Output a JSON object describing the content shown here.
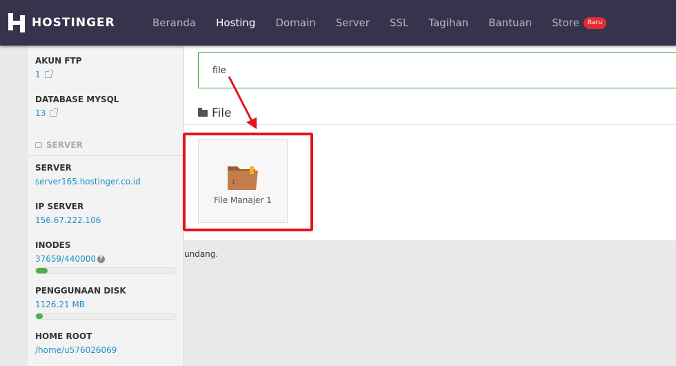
{
  "brand": {
    "name": "HOSTINGER"
  },
  "nav": {
    "items": [
      "Beranda",
      "Hosting",
      "Domain",
      "Server",
      "SSL",
      "Tagihan",
      "Bantuan",
      "Store"
    ],
    "active": "Hosting",
    "store_badge": "Baru"
  },
  "sidebar": {
    "ftp": {
      "title": "AKUN FTP",
      "value": "1"
    },
    "mysql": {
      "title": "DATABASE MYSQL",
      "value": "13"
    },
    "section_label": "SERVER",
    "server": {
      "title": "SERVER",
      "value": "server165.hostinger.co.id"
    },
    "ip": {
      "title": "IP SERVER",
      "value": "156.67.222.106"
    },
    "inodes": {
      "title": "INODES",
      "value": "37659/440000",
      "help": "?",
      "usage": 0.086
    },
    "disk": {
      "title": "PENGGUNAAN DISK",
      "value": "1126.21 MB",
      "usage": 0.05
    },
    "home": {
      "title": "HOME ROOT",
      "value": "/home/u576026069"
    }
  },
  "main": {
    "search_value": "file",
    "section_title": "File",
    "tile_label": "File Manajer 1",
    "tile_badge": "1",
    "footer_text": "undang."
  },
  "colors": {
    "topbar": "#36344d",
    "link": "#1e8fc7",
    "highlight": "#e6121a",
    "progress": "#4cae4c",
    "folder": "#b87345"
  },
  "icons": [
    "external-link-icon",
    "server-icon",
    "help-icon",
    "folder-open-icon",
    "folder-icon"
  ]
}
